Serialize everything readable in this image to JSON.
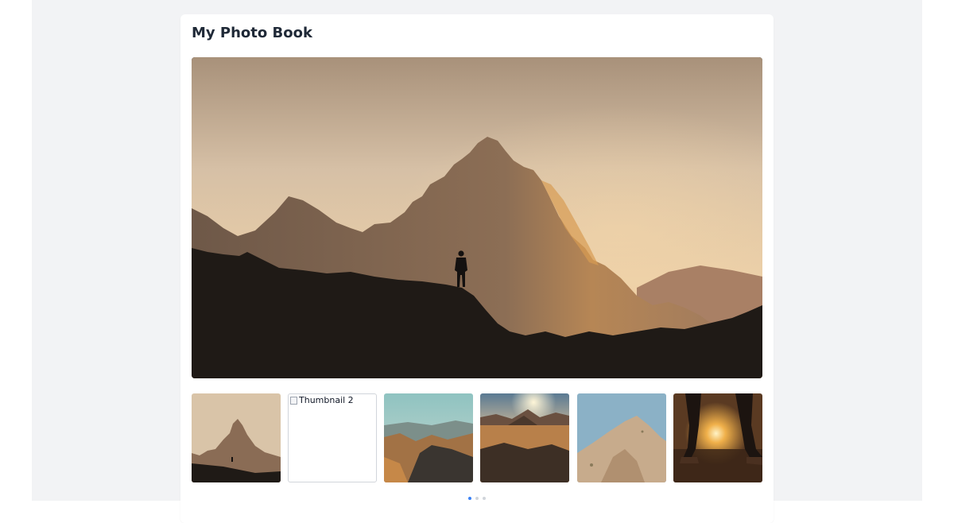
{
  "page": {
    "title": "My Photo Book"
  },
  "hero": {
    "image": "mountain-silhouette-sunset"
  },
  "thumbnails": [
    {
      "image": "mountain-silhouette-sunset",
      "alt": "",
      "broken": false
    },
    {
      "image": "",
      "alt": "Thumbnail 2",
      "broken": true
    },
    {
      "image": "desert-rock-valley-aerial",
      "alt": "",
      "broken": false
    },
    {
      "image": "desert-sunset-peaks",
      "alt": "",
      "broken": false
    },
    {
      "image": "rocky-cliff-blue-sky",
      "alt": "",
      "broken": false
    },
    {
      "image": "hiker-legs-sunset",
      "alt": "",
      "broken": false
    }
  ],
  "pagination": {
    "total": 3,
    "active": 1
  },
  "colors": {
    "page_background": "#f2f3f5",
    "card_background": "#ffffff",
    "title_text": "#1f2937",
    "active_dot": "#3b82f6",
    "inactive_dot": "#d1d5db"
  }
}
